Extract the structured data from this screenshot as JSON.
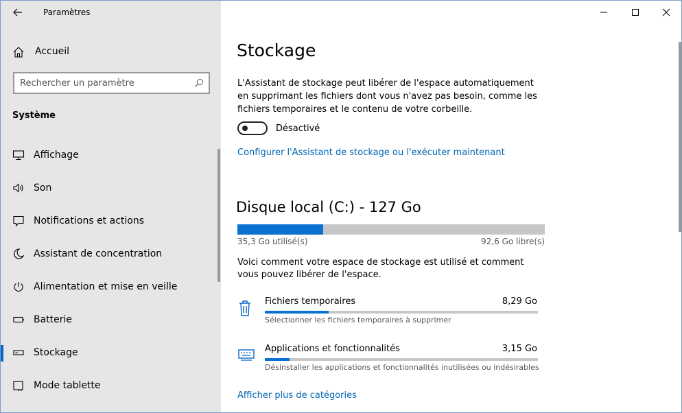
{
  "window": {
    "title": "Paramètres",
    "minimize_glyph": "—",
    "close_glyph": "✕"
  },
  "sidebar": {
    "home_label": "Accueil",
    "search_placeholder": "Rechercher un paramètre",
    "section_title": "Système",
    "items": [
      {
        "label": "Affichage",
        "icon": "display-icon",
        "selected": false
      },
      {
        "label": "Son",
        "icon": "speaker-icon",
        "selected": false
      },
      {
        "label": "Notifications et actions",
        "icon": "notification-icon",
        "selected": false
      },
      {
        "label": "Assistant de concentration",
        "icon": "moon-icon",
        "selected": false
      },
      {
        "label": "Alimentation et mise en veille",
        "icon": "power-icon",
        "selected": false
      },
      {
        "label": "Batterie",
        "icon": "battery-icon",
        "selected": false
      },
      {
        "label": "Stockage",
        "icon": "storage-icon",
        "selected": true
      },
      {
        "label": "Mode tablette",
        "icon": "tablet-icon",
        "selected": false
      }
    ]
  },
  "main": {
    "title": "Stockage",
    "description": "L'Assistant de stockage peut libérer de l'espace automatiquement en supprimant les fichiers dont vous n'avez pas besoin, comme les fichiers temporaires et le contenu de votre corbeille.",
    "toggle": {
      "state": "off",
      "label": "Désactivé"
    },
    "configure_link": "Configurer l'Assistant de stockage ou l'exécuter maintenant",
    "disk": {
      "title": "Disque local (C:) - 127 Go",
      "used_label": "35,3 Go utilisé(s)",
      "free_label": "92,6 Go libre(s)",
      "used_fraction": 0.278
    },
    "usage_description": "Voici comment votre espace de stockage est utilisé et comment vous pouvez libérer de l'espace.",
    "categories": [
      {
        "name": "Fichiers temporaires",
        "size": "8,29 Go",
        "subtitle": "Sélectionner les fichiers temporaires à supprimer",
        "fraction": 0.234,
        "icon": "trash-icon"
      },
      {
        "name": "Applications et fonctionnalités",
        "size": "3,15 Go",
        "subtitle": "Désinstaller les applications et fonctionnalités inutilisées ou indésirables",
        "fraction": 0.09,
        "icon": "keyboard-icon"
      }
    ],
    "more_link": "Afficher plus de catégories"
  },
  "colors": {
    "accent": "#0a71d0",
    "link": "#0066b4",
    "sidebar_bg": "#e6e6e6"
  }
}
